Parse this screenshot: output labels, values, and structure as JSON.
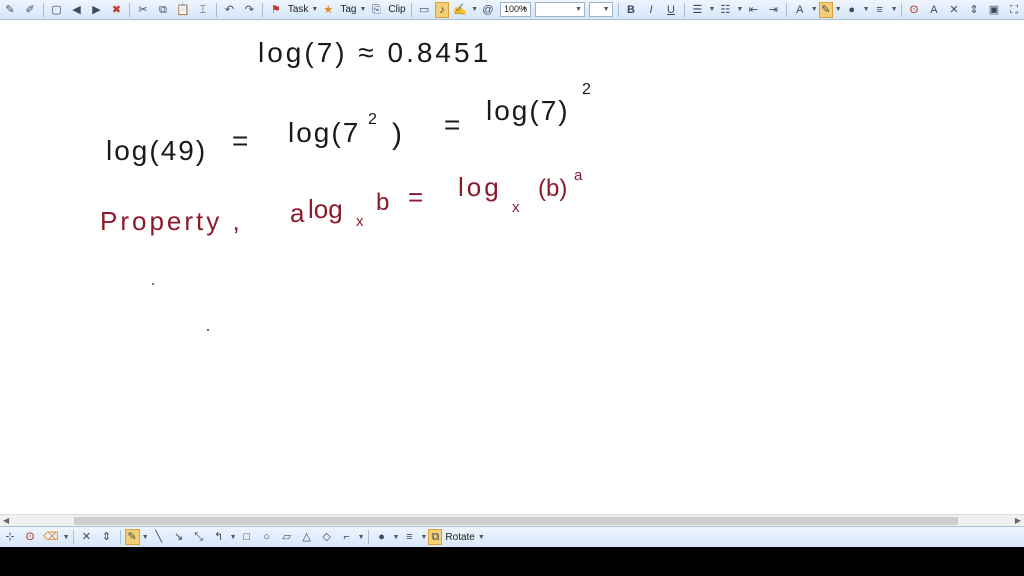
{
  "toolbar": {
    "task_label": "Task",
    "tag_label": "Tag",
    "clip_label": "Clip",
    "zoom_value": "100%",
    "bold": "B",
    "italic": "I",
    "underline": "U",
    "font_a": "A",
    "font_size_a": "A"
  },
  "canvas": {
    "line1": "log(7) ≈ 0.8451",
    "line2_left": "log(49)",
    "line2_eq": "=",
    "line2_mid": "log(7",
    "line2_mid_exp": "2",
    "line2_mid_close": ")",
    "line2_eq2": "=",
    "line2_right": "log(7)",
    "line2_right_exp": "2",
    "line3_label": "Property ,",
    "line3_a": "a",
    "line3_log": "log",
    "line3_sub": "x",
    "line3_b": "b",
    "line3_eq": "=",
    "line3_rlog": "log",
    "line3_rsub": "x",
    "line3_rb": "(b)",
    "line3_rexp": "a",
    "ink_black": "#1a1a1a",
    "ink_red": "#8b1a2b"
  },
  "drawbar": {
    "rotate_label": "Rotate"
  }
}
